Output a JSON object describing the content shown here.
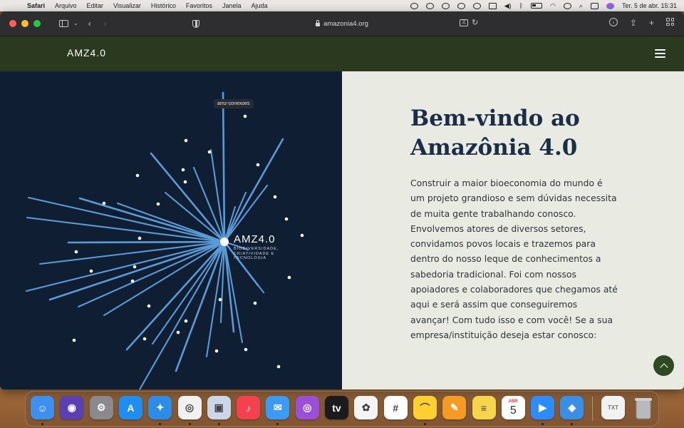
{
  "menubar": {
    "app_name": "Safari",
    "menus": [
      "Arquivo",
      "Editar",
      "Visualizar",
      "Histórico",
      "Favoritos",
      "Janela",
      "Ajuda"
    ],
    "datetime": "Ter. 5 de abr.  15:31"
  },
  "browser": {
    "url": "amazonia4.org"
  },
  "site": {
    "logo": "AMZ4.0",
    "tooltip": "amz-conexoes",
    "burst_logo_title": "AMZ4.0",
    "burst_logo_subtitle": "BIODIVERSIDADE, CRIATIVIDADE E TECNOLOGIA",
    "welcome_title": "Bem-vindo ao Amazônia 4.0",
    "welcome_body": "Construir a maior bioeconomia do mundo é um projeto grandioso e sem dúvidas necessita de muita gente trabalhando conosco. Envolvemos atores de diversos setores, convidamos povos locais e trazemos para dentro do nosso leque de conhecimentos a sabedoria tradicional. Foi com nossos apoiadores e colaboradores que chegamos até aqui e será assim que conseguiremos avançar! Com tudo isso e com você! Se a sua empresa/instituição deseja estar conosco:"
  },
  "colors": {
    "header_green": "#2b3a1f",
    "hero_navy": "#0f1e33",
    "ray_blue": "#5b9bd5",
    "title_navy": "#1b2d47",
    "panel_bg": "#e9ebe3"
  },
  "dock": {
    "apps": [
      {
        "name": "finder-icon",
        "color": "#3d8ff0",
        "glyph": "☺"
      },
      {
        "name": "siri-icon",
        "color": "#5a3fb5",
        "glyph": "◉"
      },
      {
        "name": "system-preferences-icon",
        "color": "#8a8a8e",
        "glyph": "⚙"
      },
      {
        "name": "app-store-icon",
        "color": "#1f8ef1",
        "glyph": "A"
      },
      {
        "name": "safari-icon",
        "color": "#2c8ce6",
        "glyph": "✦"
      },
      {
        "name": "chrome-icon",
        "color": "#f1f1f1",
        "glyph": "◎"
      },
      {
        "name": "preview-icon",
        "color": "#c9d7e8",
        "glyph": "▣"
      },
      {
        "name": "music-icon",
        "color": "#f5404f",
        "glyph": "♪"
      },
      {
        "name": "mail-icon",
        "color": "#3b9af5",
        "glyph": "✉"
      },
      {
        "name": "podcasts-icon",
        "color": "#9b4fd8",
        "glyph": "◎"
      },
      {
        "name": "apple-tv-icon",
        "color": "#1b1b1d",
        "glyph": "tv"
      },
      {
        "name": "photos-icon",
        "color": "#f4f4f4",
        "glyph": "✿"
      },
      {
        "name": "slack-icon",
        "color": "#ffffff",
        "glyph": "#"
      },
      {
        "name": "miro-icon",
        "color": "#ffd02f",
        "glyph": "⌒"
      },
      {
        "name": "pages-icon",
        "color": "#f59a23",
        "glyph": "✎"
      },
      {
        "name": "notes-icon",
        "color": "#f7d54a",
        "glyph": "≡"
      },
      {
        "name": "calendar-icon",
        "color": "#ffffff",
        "glyph": "5"
      },
      {
        "name": "zoom-icon",
        "color": "#2d8cff",
        "glyph": "▶"
      },
      {
        "name": "keynote-icon",
        "color": "#3a8ee6",
        "glyph": "◈"
      }
    ],
    "calendar_month": "ABR",
    "calendar_day": "5"
  }
}
